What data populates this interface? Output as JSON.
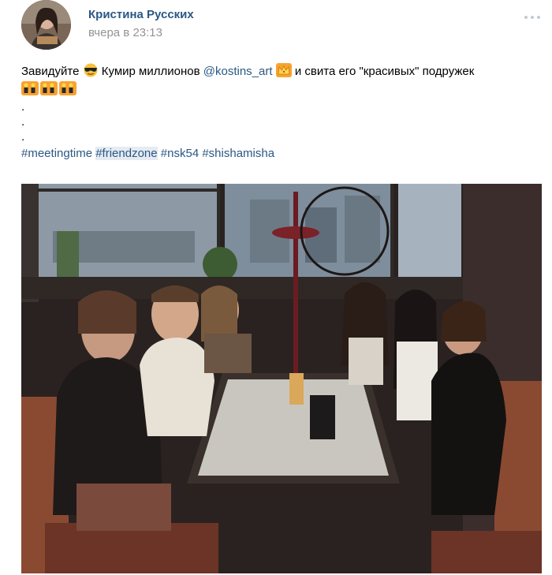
{
  "post": {
    "author": "Кристина Русских",
    "time": "вчера в 23:13",
    "text_part1": "Завидуйте",
    "text_part2": "Кумир миллионов",
    "mention": "@kostins_art",
    "text_part3": "и свита его \"красивых\" подружек",
    "dots": [
      ".",
      ".",
      "."
    ],
    "hashtags": [
      "#meetingtime",
      "#friendzone",
      "#nsk54",
      "#shishamisha"
    ]
  },
  "icons": {
    "avatar": "avatar-photo",
    "more": "more-dots-icon",
    "emoji1": "sunglasses-emoji",
    "emoji2": "crown-emoji",
    "emoji3": "dancers-emoji"
  },
  "colors": {
    "link": "#2a5885",
    "secondary": "#939393",
    "hashtag_highlight": "#e5ebf1"
  }
}
